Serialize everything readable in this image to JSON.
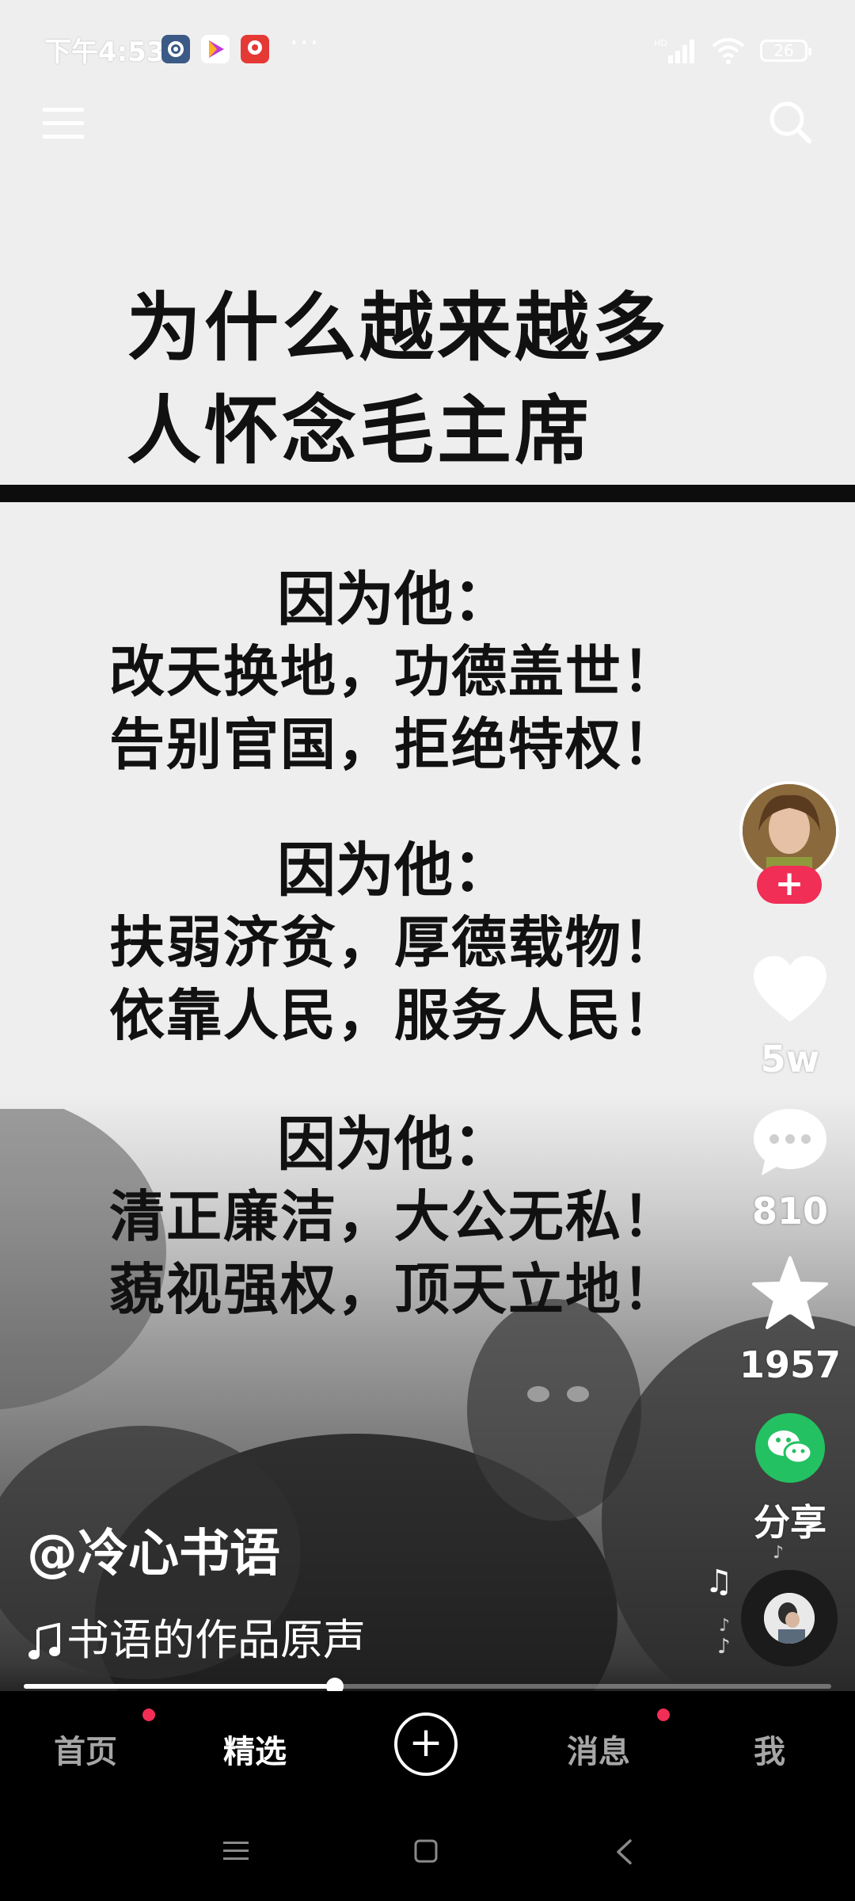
{
  "status_bar": {
    "time": "下午4:53",
    "network": "HD",
    "battery": "26"
  },
  "video": {
    "title_lines": [
      "为什么越来越多",
      "人怀念毛主席"
    ],
    "blocks": [
      {
        "head": "因为他：",
        "lines": [
          "改天换地，功德盖世！",
          "告别官国，拒绝特权！"
        ]
      },
      {
        "head": "因为他：",
        "lines": [
          "扶弱济贫，厚德载物！",
          "依靠人民，服务人民！"
        ]
      },
      {
        "head": "因为他：",
        "lines": [
          "清正廉洁，大公无私！",
          "藐视强权，顶天立地！"
        ]
      }
    ]
  },
  "actions": {
    "follow": "+",
    "likes": "5w",
    "comments": "810",
    "favorites": "1957",
    "share_label": "分享"
  },
  "author": {
    "username": "@冷心书语"
  },
  "music": {
    "title": "书语的作品原声"
  },
  "playback": {
    "progress": 0.385
  },
  "nav": {
    "items": [
      "首页",
      "精选",
      "消息",
      "我"
    ],
    "add": "+"
  },
  "colors": {
    "accent": "#f02e56",
    "wechat": "#23c162"
  },
  "icons": [
    "settings-app-icon",
    "video-app-icon",
    "red-app-icon",
    "menu-icon",
    "search-icon",
    "heart-icon",
    "comment-icon",
    "star-icon",
    "wechat-icon",
    "music-note-icon"
  ]
}
